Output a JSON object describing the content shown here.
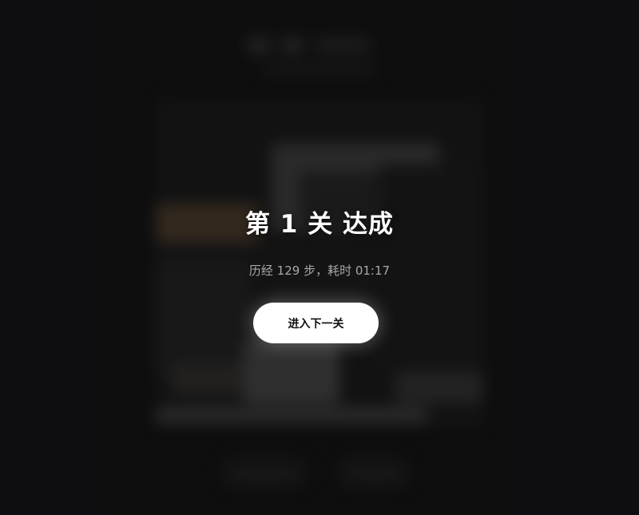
{
  "modal": {
    "title": "第 1 关 达成",
    "stats": "历经 129 步，耗时 01:17",
    "next_button_label": "进入下一关"
  },
  "colors": {
    "background": "#111113",
    "title": "#ffffff",
    "stats": "#a8a8ab",
    "button_bg": "#ffffff",
    "button_text": "#111111"
  }
}
